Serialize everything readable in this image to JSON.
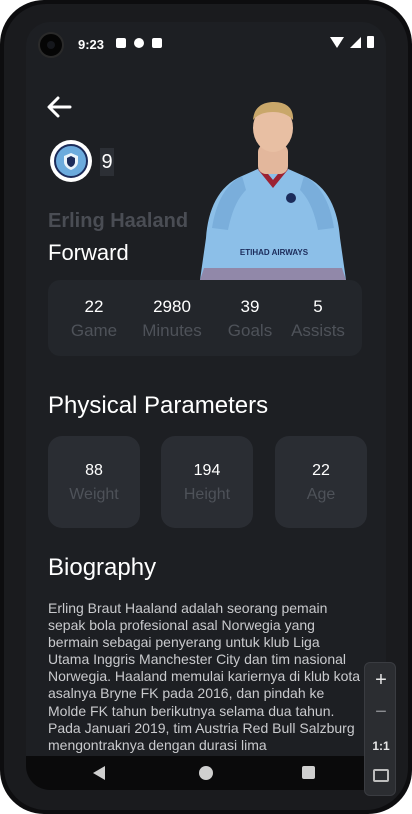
{
  "status_bar": {
    "time": "9:23"
  },
  "header": {
    "back_label": "back"
  },
  "player": {
    "jersey_number": "9",
    "name": "Erling Haaland",
    "position": "Forward",
    "shirt_sponsor": "ETIHAD AIRWAYS"
  },
  "stats": [
    {
      "value": "22",
      "label": "Game"
    },
    {
      "value": "2980",
      "label": "Minutes"
    },
    {
      "value": "39",
      "label": "Goals"
    },
    {
      "value": "5",
      "label": "Assists"
    }
  ],
  "physical": {
    "title": "Physical Parameters",
    "items": [
      {
        "value": "88",
        "label": "Weight"
      },
      {
        "value": "194",
        "label": "Height"
      },
      {
        "value": "22",
        "label": "Age"
      }
    ]
  },
  "biography": {
    "title": "Biography",
    "text": "Erling Braut Haaland adalah seorang pemain sepak bola profesional asal Norwegia yang bermain sebagai penyerang untuk klub Liga Utama Inggris Manchester City dan tim nasional Norwegia. Haaland memulai kariernya di klub kota asalnya Bryne FK pada 2016, dan pindah ke Molde FK tahun berikutnya selama dua tahun. Pada Januari 2019, tim Austria Red Bull Salzburg mengontraknya dengan durasi lima"
  },
  "zoom_controls": {
    "plus": "+",
    "minus": "−",
    "one_to_one": "1:1"
  },
  "colors": {
    "background": "#1d1f23",
    "card": "#23262b",
    "muted_text": "#4e5259",
    "shirt": "#8cbfe8"
  }
}
